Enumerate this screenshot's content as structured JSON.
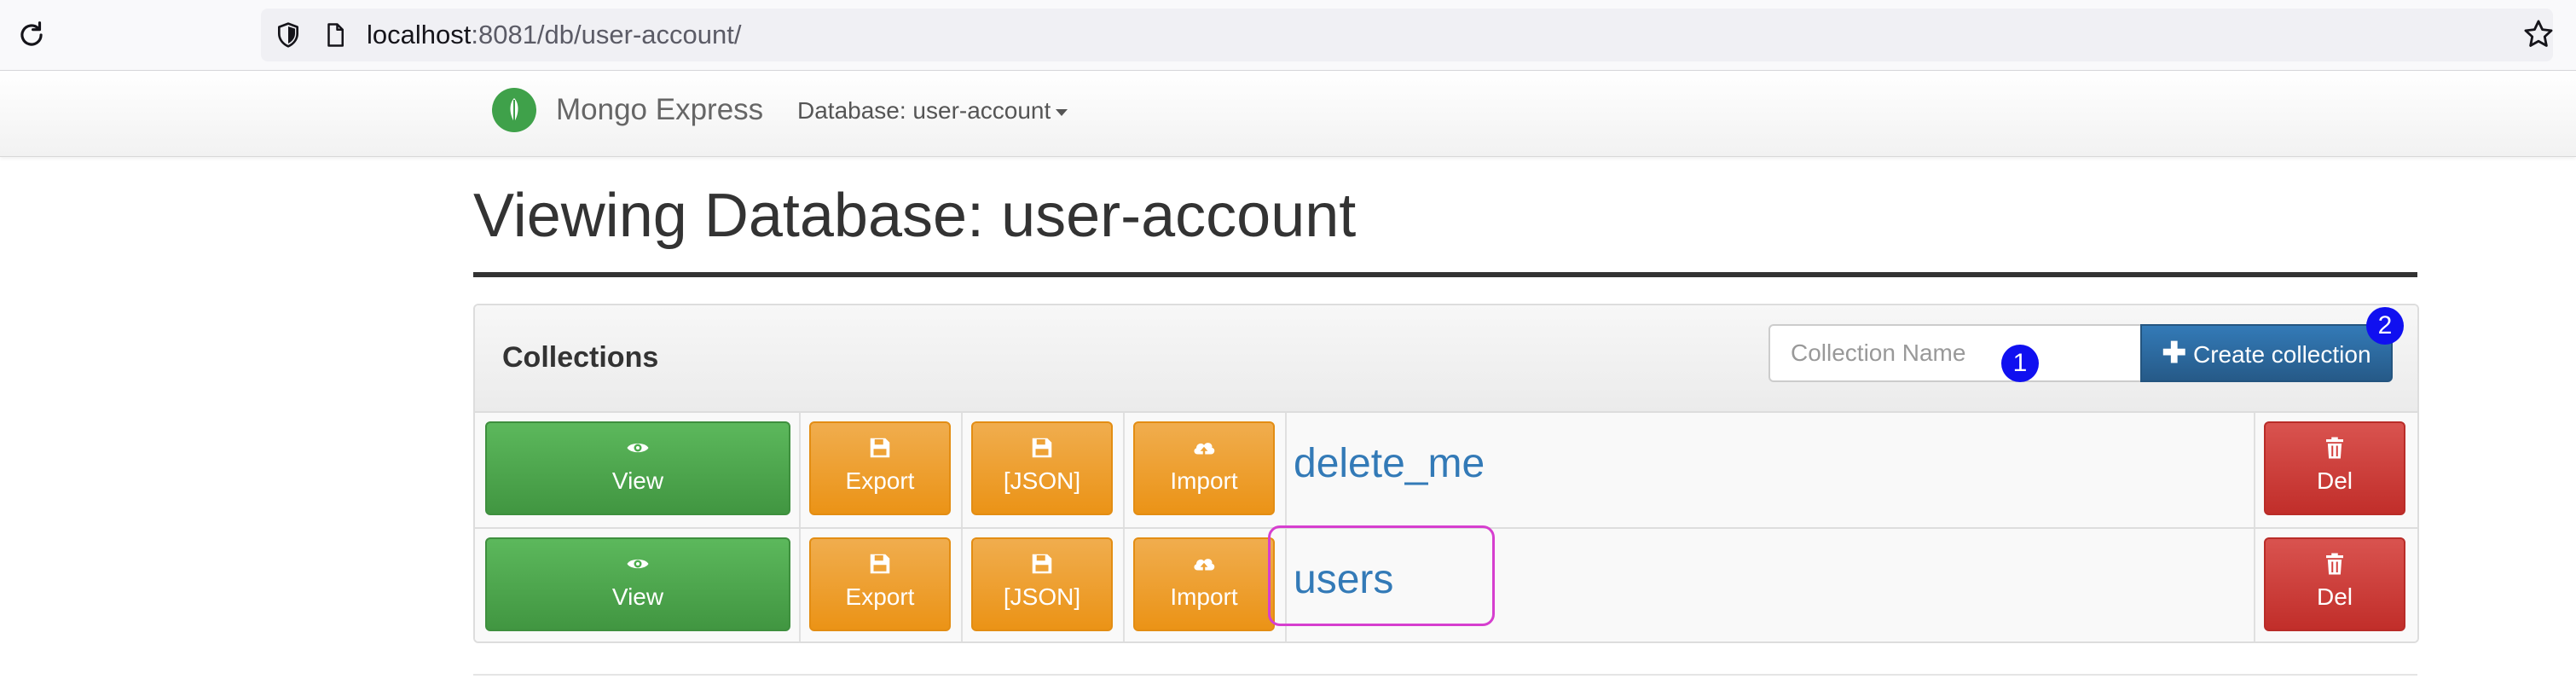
{
  "browser": {
    "url_host": "localhost",
    "url_rest": ":8081/db/user-account/"
  },
  "navbar": {
    "brand": "Mongo Express",
    "database_dropdown": "Database: user-account"
  },
  "page": {
    "title": "Viewing Database: user-account"
  },
  "panel": {
    "heading": "Collections",
    "collection_name_placeholder": "Collection Name",
    "create_button_label": "Create collection"
  },
  "collections": [
    {
      "name": "delete_me",
      "view": "View",
      "export": "Export",
      "json": "[JSON]",
      "import": "Import",
      "del": "Del"
    },
    {
      "name": "users",
      "view": "View",
      "export": "Export",
      "json": "[JSON]",
      "import": "Import",
      "del": "Del"
    }
  ],
  "annotations": {
    "badge_1": "1",
    "badge_2": "2"
  },
  "colors": {
    "view_button": "#5cb85c",
    "action_button": "#f0ad4e",
    "delete_button": "#d9534f",
    "create_button": "#337ab7",
    "link": "#337ab7",
    "badge": "#1010f0",
    "highlight": "#d63fcf"
  },
  "icons": {
    "reload": "reload-icon",
    "shield": "shield-icon",
    "page": "page-icon",
    "bookmark": "star-icon",
    "logo": "mongo-leaf-icon",
    "view": "eye-icon",
    "export": "save-icon",
    "json": "save-icon",
    "import": "cloud-upload-icon",
    "delete": "trash-icon",
    "create": "plus-icon"
  }
}
